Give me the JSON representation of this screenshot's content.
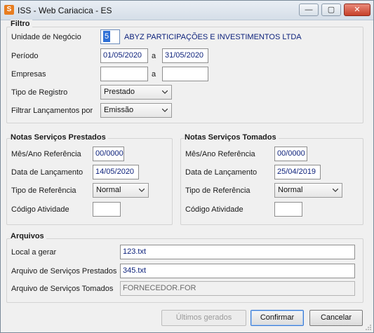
{
  "window": {
    "title": "ISS - Web Cariacica - ES",
    "icon_glyph": "S",
    "min_glyph": "—",
    "max_glyph": "▢",
    "close_glyph": "✕"
  },
  "filtro": {
    "title": "Filtro",
    "unidade_label": "Unidade de Negócio",
    "unidade_code": "5",
    "unidade_name": "ABYZ PARTICIPAÇÕES E INVESTIMENTOS LTDA",
    "periodo_label": "Período",
    "periodo_from": "01/05/2020",
    "periodo_a": "a",
    "periodo_to": "31/05/2020",
    "empresas_label": "Empresas",
    "empresas_from": "",
    "empresas_a": "a",
    "empresas_to": "",
    "tipo_registro_label": "Tipo de Registro",
    "tipo_registro_value": "Prestado",
    "filtrar_label": "Filtrar Lançamentos por",
    "filtrar_value": "Emissão"
  },
  "prestados": {
    "title": "Notas Serviços Prestados",
    "mes_ano_label": "Mês/Ano Referência",
    "mes_ano_value": "00/0000",
    "data_lanc_label": "Data de Lançamento",
    "data_lanc_value": "14/05/2020",
    "tipo_ref_label": "Tipo de Referência",
    "tipo_ref_value": "Normal",
    "codigo_label": "Código Atividade",
    "codigo_value": ""
  },
  "tomados": {
    "title": "Notas Serviços Tomados",
    "mes_ano_label": "Mês/Ano Referência",
    "mes_ano_value": "00/0000",
    "data_lanc_label": "Data de Lançamento",
    "data_lanc_value": "25/04/2019",
    "tipo_ref_label": "Tipo de Referência",
    "tipo_ref_value": "Normal",
    "codigo_label": "Código Atividade",
    "codigo_value": ""
  },
  "arquivos": {
    "title": "Arquivos",
    "local_label": "Local a gerar",
    "local_value": "123.txt",
    "prestados_label": "Arquivo de Serviços Prestados",
    "prestados_value": "345.txt",
    "tomados_label": "Arquivo de Serviços Tomados",
    "tomados_value": "FORNECEDOR.FOR"
  },
  "buttons": {
    "ultimos": "Últimos gerados",
    "confirmar": "Confirmar",
    "cancelar": "Cancelar"
  }
}
